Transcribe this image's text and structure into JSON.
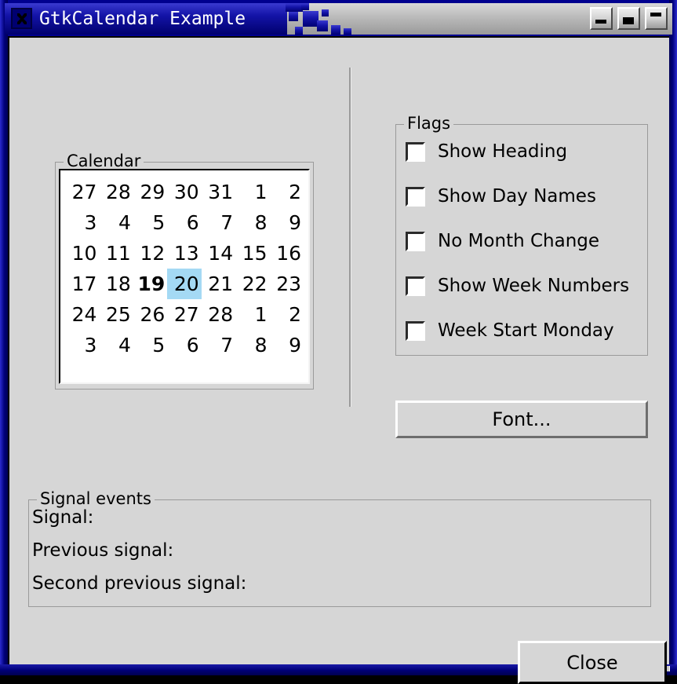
{
  "window": {
    "title": "GtkCalendar Example",
    "icon": "close-x-icon",
    "controls": [
      {
        "name": "minimize-button",
        "glyph": "minimize"
      },
      {
        "name": "maximize-button",
        "glyph": "maximize"
      },
      {
        "name": "close-button",
        "glyph": "close"
      }
    ],
    "accent_titlebar": "#1414a8",
    "bg": "#d6d6d6"
  },
  "calendar": {
    "frame_label": "Calendar",
    "selected_day": "20",
    "today": "19",
    "selection_color": "#a4d9f4",
    "dim_color": "#c2c2c2",
    "weeks": [
      [
        {
          "day": "27",
          "state": "prev"
        },
        {
          "day": "28",
          "state": "prev"
        },
        {
          "day": "29",
          "state": "prev"
        },
        {
          "day": "30",
          "state": "prev"
        },
        {
          "day": "31",
          "state": "prev"
        },
        {
          "day": "1",
          "state": "current"
        },
        {
          "day": "2",
          "state": "current"
        }
      ],
      [
        {
          "day": "3",
          "state": "current"
        },
        {
          "day": "4",
          "state": "current"
        },
        {
          "day": "5",
          "state": "current"
        },
        {
          "day": "6",
          "state": "current"
        },
        {
          "day": "7",
          "state": "current"
        },
        {
          "day": "8",
          "state": "current"
        },
        {
          "day": "9",
          "state": "current"
        }
      ],
      [
        {
          "day": "10",
          "state": "current"
        },
        {
          "day": "11",
          "state": "current"
        },
        {
          "day": "12",
          "state": "current"
        },
        {
          "day": "13",
          "state": "current"
        },
        {
          "day": "14",
          "state": "current"
        },
        {
          "day": "15",
          "state": "current"
        },
        {
          "day": "16",
          "state": "current"
        }
      ],
      [
        {
          "day": "17",
          "state": "current"
        },
        {
          "day": "18",
          "state": "current"
        },
        {
          "day": "19",
          "state": "today"
        },
        {
          "day": "20",
          "state": "selected"
        },
        {
          "day": "21",
          "state": "current"
        },
        {
          "day": "22",
          "state": "current"
        },
        {
          "day": "23",
          "state": "current"
        }
      ],
      [
        {
          "day": "24",
          "state": "current"
        },
        {
          "day": "25",
          "state": "current"
        },
        {
          "day": "26",
          "state": "current"
        },
        {
          "day": "27",
          "state": "current"
        },
        {
          "day": "28",
          "state": "current"
        },
        {
          "day": "1",
          "state": "next"
        },
        {
          "day": "2",
          "state": "next"
        }
      ],
      [
        {
          "day": "3",
          "state": "next"
        },
        {
          "day": "4",
          "state": "next"
        },
        {
          "day": "5",
          "state": "next"
        },
        {
          "day": "6",
          "state": "next"
        },
        {
          "day": "7",
          "state": "next"
        },
        {
          "day": "8",
          "state": "next"
        },
        {
          "day": "9",
          "state": "next"
        }
      ]
    ]
  },
  "flags": {
    "frame_label": "Flags",
    "items": [
      {
        "label": "Show Heading",
        "checked": false,
        "name": "checkbox-show-heading"
      },
      {
        "label": "Show Day Names",
        "checked": false,
        "name": "checkbox-show-day-names"
      },
      {
        "label": "No Month Change",
        "checked": false,
        "name": "checkbox-no-month-change"
      },
      {
        "label": "Show Week Numbers",
        "checked": false,
        "name": "checkbox-show-week-numbers"
      },
      {
        "label": "Week Start Monday",
        "checked": false,
        "name": "checkbox-week-start-monday"
      }
    ]
  },
  "buttons": {
    "font": "Font...",
    "close": "Close"
  },
  "signal_events": {
    "frame_label": "Signal events",
    "rows": [
      {
        "label": "Signal:",
        "value": ""
      },
      {
        "label": "Previous signal:",
        "value": ""
      },
      {
        "label": "Second previous signal:",
        "value": ""
      }
    ]
  }
}
